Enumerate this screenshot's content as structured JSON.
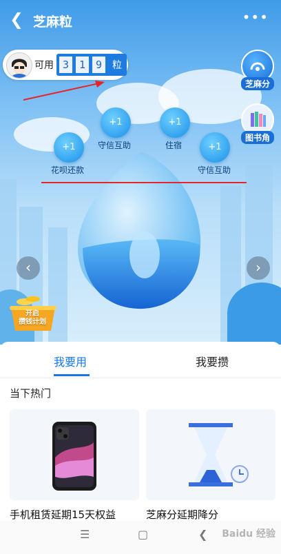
{
  "header": {
    "title": "芝麻粒",
    "back_icon": "back-arrow-icon",
    "more_icon": "more-dots-icon"
  },
  "balance": {
    "label": "可用",
    "digits": [
      "3",
      "1",
      "9"
    ],
    "unit": "粒"
  },
  "side_buttons": [
    {
      "label": "芝麻分",
      "icon": "sesame-score-icon"
    },
    {
      "label": "图书角",
      "icon": "books-icon"
    }
  ],
  "bubbles": [
    {
      "value": "+1",
      "label": "花呗还款"
    },
    {
      "value": "+1",
      "label": "守信互助"
    },
    {
      "value": "+1",
      "label": "住宿"
    },
    {
      "value": "+1",
      "label": "守信互助"
    }
  ],
  "promo": {
    "label_line1": "开启",
    "label_line2": "攒钱计划"
  },
  "tabs": [
    {
      "label": "我要用",
      "active": true
    },
    {
      "label": "我要攒",
      "active": false
    }
  ],
  "section_title": "当下热门",
  "cards": [
    {
      "title": "手机租赁延期15天权益",
      "image": "phone-image"
    },
    {
      "title": "芝麻分延期降分",
      "image": "hourglass-image"
    }
  ],
  "watermark": "Baidu 经验",
  "colors": {
    "accent": "#1677e6",
    "annotation": "#e8232a"
  }
}
